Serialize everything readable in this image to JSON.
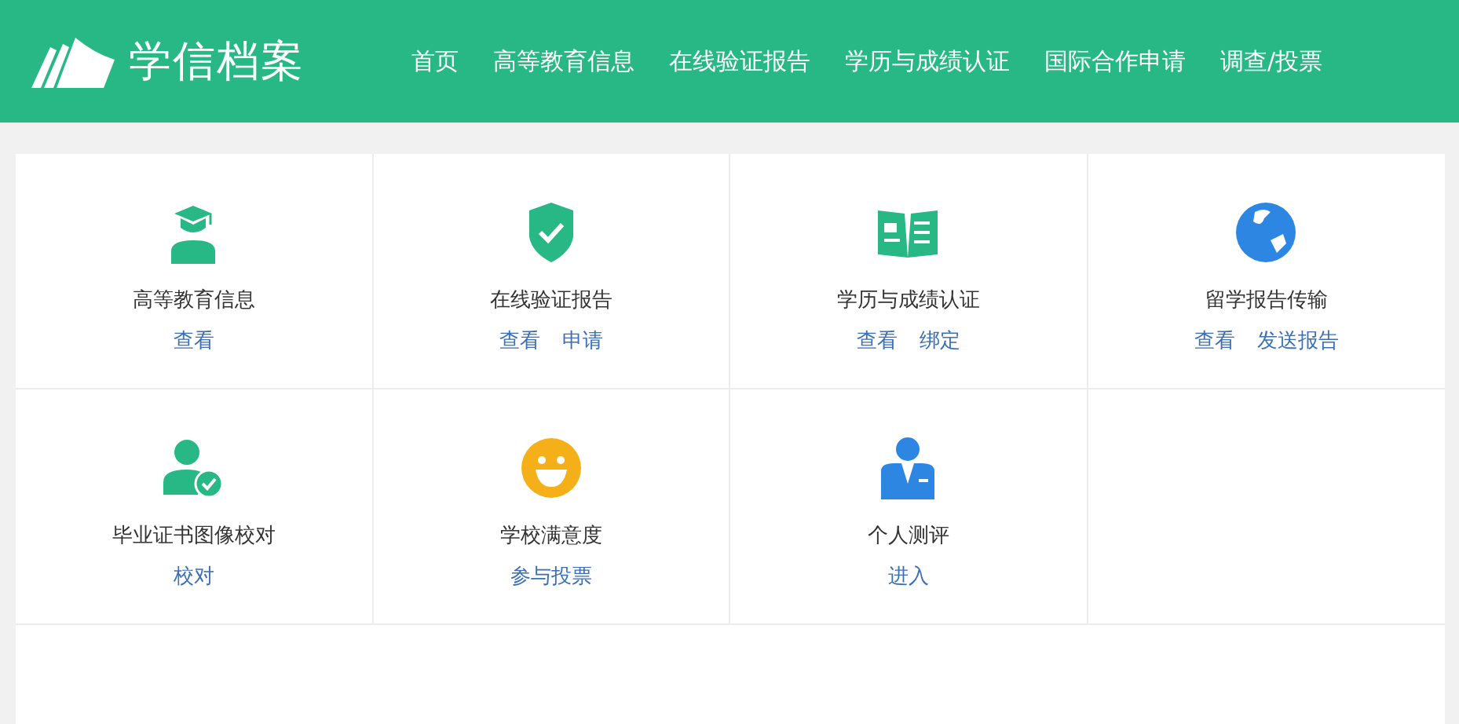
{
  "header": {
    "logo_text": "学信档案",
    "nav": [
      {
        "label": "首页"
      },
      {
        "label": "高等教育信息"
      },
      {
        "label": "在线验证报告"
      },
      {
        "label": "学历与成绩认证"
      },
      {
        "label": "国际合作申请"
      },
      {
        "label": "调查/投票"
      }
    ]
  },
  "tiles": [
    {
      "title": "高等教育信息",
      "links": [
        "查看"
      ]
    },
    {
      "title": "在线验证报告",
      "links": [
        "查看",
        "申请"
      ]
    },
    {
      "title": "学历与成绩认证",
      "links": [
        "查看",
        "绑定"
      ]
    },
    {
      "title": "留学报告传输",
      "links": [
        "查看",
        "发送报告"
      ]
    },
    {
      "title": "毕业证书图像校对",
      "links": [
        "校对"
      ]
    },
    {
      "title": "学校满意度",
      "links": [
        "参与投票"
      ]
    },
    {
      "title": "个人测评",
      "links": [
        "进入"
      ]
    }
  ]
}
